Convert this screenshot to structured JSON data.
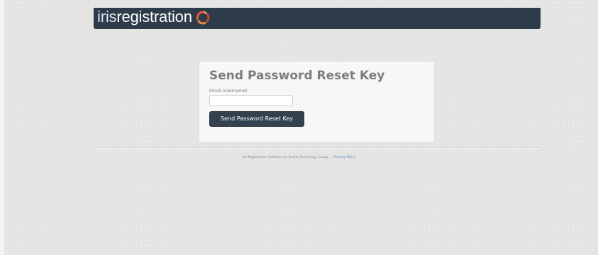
{
  "header": {
    "logo_light": "iris",
    "logo_bold": "registration",
    "logo_mark_icon": "iris-swirl-logo-icon",
    "background_color": "#2d3b4a"
  },
  "reset_form": {
    "title": "Send Password Reset Key",
    "email_label": "Email (username)",
    "email_value": "",
    "submit_label": "Send Password Reset Key",
    "button_color": "#34414f"
  },
  "footer": {
    "credit_text": "Iris Registration Software by Searle Technology Group",
    "separator": "|",
    "privacy_link": "Privacy Policy",
    "link_color": "#5b86b5"
  }
}
